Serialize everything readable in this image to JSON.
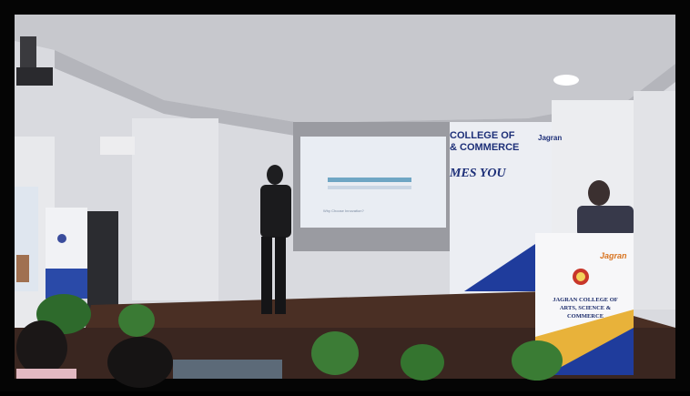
{
  "banner": {
    "line1": "COLLEGE OF",
    "line2": "& COMMERCE",
    "welcome": "MES YOU",
    "brand_small": "Jagran"
  },
  "podium": {
    "logo_text": "Jagran",
    "name_line1": "JAGRAN COLLEGE OF",
    "name_line2": "ARTS, SCIENCE & COMMERCE"
  },
  "projection": {
    "footer_text": "Why Choose Innovation?"
  },
  "colors": {
    "banner_blue": "#1d2f78",
    "podium_orange": "#d8731f",
    "stage_floor": "#4a2f24"
  }
}
